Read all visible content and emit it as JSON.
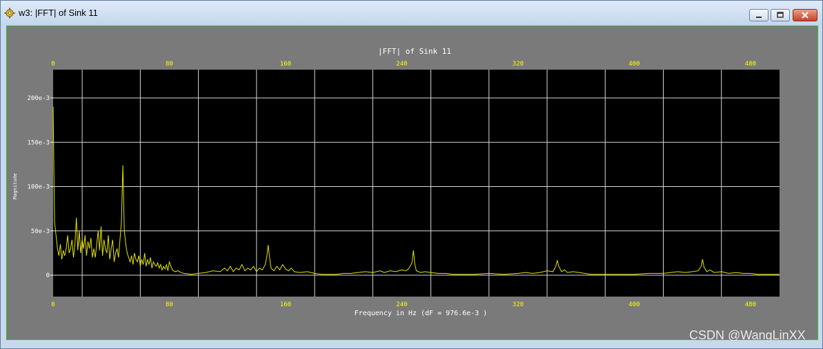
{
  "window": {
    "title": "w3: |FFT| of Sink 11"
  },
  "icons": {
    "app": "gear-icon",
    "minimize": "minimize-icon",
    "maximize": "maximize-icon",
    "close": "close-icon"
  },
  "watermark": "CSDN @WangLinXX",
  "colors": {
    "plot_bg": "#000000",
    "frame_bg": "#7a7a7a",
    "grid": "#d8d8d8",
    "trace": "#e6e600",
    "axis_text": "#ffff00",
    "label_text": "#ffffff"
  },
  "chart_data": {
    "type": "line",
    "title": "|FFT| of Sink 11",
    "xlabel": "Frequency in Hz (dF = 976.6e-3 )",
    "ylabel": "Magnitude",
    "xlim": [
      0,
      500
    ],
    "ylim": [
      -22,
      232
    ],
    "x_ticks": [
      0,
      80,
      160,
      240,
      320,
      400,
      480
    ],
    "y_ticks": [
      0,
      0.05,
      0.1,
      0.15,
      0.2
    ],
    "y_tick_labels": [
      "0",
      "50e-3",
      "100e-3",
      "150e-3",
      "200e-3"
    ],
    "grid": true,
    "series": [
      {
        "name": "",
        "points": [
          [
            0,
            0.19
          ],
          [
            1,
            0.06
          ],
          [
            2,
            0.045
          ],
          [
            3,
            0.03
          ],
          [
            4,
            0.022
          ],
          [
            5,
            0.035
          ],
          [
            6,
            0.018
          ],
          [
            7,
            0.028
          ],
          [
            8,
            0.022
          ],
          [
            9,
            0.03
          ],
          [
            10,
            0.045
          ],
          [
            11,
            0.025
          ],
          [
            12,
            0.03
          ],
          [
            13,
            0.04
          ],
          [
            14,
            0.02
          ],
          [
            15,
            0.035
          ],
          [
            16,
            0.065
          ],
          [
            17,
            0.028
          ],
          [
            18,
            0.05
          ],
          [
            19,
            0.025
          ],
          [
            20,
            0.04
          ],
          [
            21,
            0.03
          ],
          [
            22,
            0.045
          ],
          [
            23,
            0.022
          ],
          [
            24,
            0.038
          ],
          [
            25,
            0.03
          ],
          [
            26,
            0.042
          ],
          [
            27,
            0.02
          ],
          [
            28,
            0.03
          ],
          [
            29,
            0.02
          ],
          [
            30,
            0.035
          ],
          [
            31,
            0.05
          ],
          [
            32,
            0.028
          ],
          [
            33,
            0.055
          ],
          [
            34,
            0.022
          ],
          [
            35,
            0.04
          ],
          [
            36,
            0.03
          ],
          [
            37,
            0.025
          ],
          [
            38,
            0.045
          ],
          [
            39,
            0.018
          ],
          [
            40,
            0.03
          ],
          [
            41,
            0.04
          ],
          [
            42,
            0.015
          ],
          [
            43,
            0.025
          ],
          [
            44,
            0.03
          ],
          [
            45,
            0.02
          ],
          [
            46,
            0.04
          ],
          [
            47,
            0.06
          ],
          [
            48,
            0.124
          ],
          [
            49,
            0.05
          ],
          [
            50,
            0.035
          ],
          [
            51,
            0.025
          ],
          [
            52,
            0.02
          ],
          [
            53,
            0.015
          ],
          [
            54,
            0.022
          ],
          [
            55,
            0.012
          ],
          [
            56,
            0.025
          ],
          [
            57,
            0.018
          ],
          [
            58,
            0.015
          ],
          [
            59,
            0.022
          ],
          [
            60,
            0.01
          ],
          [
            61,
            0.018
          ],
          [
            62,
            0.012
          ],
          [
            63,
            0.025
          ],
          [
            64,
            0.01
          ],
          [
            65,
            0.018
          ],
          [
            66,
            0.012
          ],
          [
            67,
            0.02
          ],
          [
            68,
            0.008
          ],
          [
            69,
            0.015
          ],
          [
            70,
            0.012
          ],
          [
            71,
            0.01
          ],
          [
            72,
            0.014
          ],
          [
            73,
            0.008
          ],
          [
            74,
            0.012
          ],
          [
            75,
            0.006
          ],
          [
            76,
            0.01
          ],
          [
            77,
            0.007
          ],
          [
            78,
            0.012
          ],
          [
            79,
            0.005
          ],
          [
            80,
            0.015
          ],
          [
            82,
            0.006
          ],
          [
            84,
            0.004
          ],
          [
            86,
            0.005
          ],
          [
            88,
            0.003
          ],
          [
            90,
            0.002
          ],
          [
            95,
            0.001
          ],
          [
            100,
            0.002
          ],
          [
            105,
            0.003
          ],
          [
            110,
            0.005
          ],
          [
            115,
            0.004
          ],
          [
            118,
            0.008
          ],
          [
            120,
            0.005
          ],
          [
            122,
            0.01
          ],
          [
            124,
            0.004
          ],
          [
            126,
            0.008
          ],
          [
            128,
            0.006
          ],
          [
            130,
            0.012
          ],
          [
            132,
            0.005
          ],
          [
            134,
            0.008
          ],
          [
            136,
            0.006
          ],
          [
            138,
            0.01
          ],
          [
            140,
            0.004
          ],
          [
            142,
            0.008
          ],
          [
            144,
            0.006
          ],
          [
            146,
            0.012
          ],
          [
            147,
            0.02
          ],
          [
            148,
            0.034
          ],
          [
            149,
            0.02
          ],
          [
            150,
            0.008
          ],
          [
            152,
            0.005
          ],
          [
            154,
            0.01
          ],
          [
            156,
            0.006
          ],
          [
            158,
            0.012
          ],
          [
            160,
            0.007
          ],
          [
            162,
            0.005
          ],
          [
            164,
            0.008
          ],
          [
            166,
            0.004
          ],
          [
            170,
            0.003
          ],
          [
            175,
            0.004
          ],
          [
            180,
            0.002
          ],
          [
            185,
            0.001
          ],
          [
            190,
            0.001
          ],
          [
            195,
            0.001
          ],
          [
            200,
            0.002
          ],
          [
            205,
            0.002
          ],
          [
            210,
            0.003
          ],
          [
            215,
            0.004
          ],
          [
            220,
            0.003
          ],
          [
            225,
            0.005
          ],
          [
            228,
            0.003
          ],
          [
            232,
            0.005
          ],
          [
            236,
            0.004
          ],
          [
            240,
            0.006
          ],
          [
            243,
            0.005
          ],
          [
            245,
            0.008
          ],
          [
            247,
            0.014
          ],
          [
            248,
            0.028
          ],
          [
            249,
            0.012
          ],
          [
            250,
            0.005
          ],
          [
            253,
            0.003
          ],
          [
            256,
            0.004
          ],
          [
            260,
            0.003
          ],
          [
            265,
            0.002
          ],
          [
            270,
            0.002
          ],
          [
            275,
            0.001
          ],
          [
            280,
            0.001
          ],
          [
            290,
            0.001
          ],
          [
            300,
            0.002
          ],
          [
            310,
            0.001
          ],
          [
            320,
            0.002
          ],
          [
            325,
            0.003
          ],
          [
            330,
            0.002
          ],
          [
            335,
            0.003
          ],
          [
            340,
            0.005
          ],
          [
            344,
            0.004
          ],
          [
            346,
            0.01
          ],
          [
            347,
            0.017
          ],
          [
            348,
            0.01
          ],
          [
            350,
            0.004
          ],
          [
            352,
            0.006
          ],
          [
            354,
            0.003
          ],
          [
            358,
            0.004
          ],
          [
            362,
            0.003
          ],
          [
            366,
            0.002
          ],
          [
            370,
            0.001
          ],
          [
            380,
            0.001
          ],
          [
            390,
            0.001
          ],
          [
            400,
            0.001
          ],
          [
            410,
            0.002
          ],
          [
            420,
            0.002
          ],
          [
            425,
            0.003
          ],
          [
            430,
            0.004
          ],
          [
            435,
            0.003
          ],
          [
            440,
            0.004
          ],
          [
            444,
            0.005
          ],
          [
            446,
            0.01
          ],
          [
            447,
            0.018
          ],
          [
            448,
            0.009
          ],
          [
            450,
            0.004
          ],
          [
            452,
            0.006
          ],
          [
            455,
            0.003
          ],
          [
            460,
            0.004
          ],
          [
            465,
            0.002
          ],
          [
            470,
            0.003
          ],
          [
            475,
            0.002
          ],
          [
            480,
            0.002
          ],
          [
            485,
            0.001
          ],
          [
            490,
            0.001
          ],
          [
            495,
            0.001
          ],
          [
            500,
            0.001
          ]
        ]
      }
    ]
  }
}
